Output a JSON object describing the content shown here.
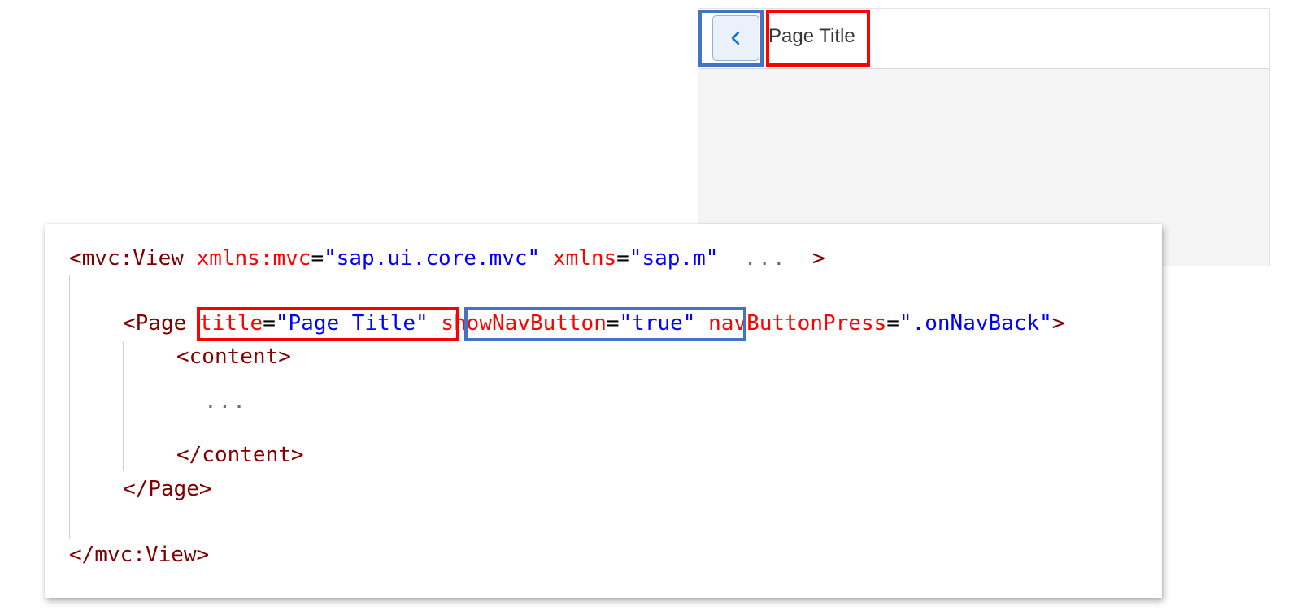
{
  "preview": {
    "page_title": "Page Title",
    "nav_button_icon": "chevron-left-icon"
  },
  "code": {
    "line1": {
      "open": "<mvc:View",
      "attr1": "xmlns:mvc",
      "eq1": "=",
      "val1": "\"sap.ui.core.mvc\"",
      "attr2": "xmlns",
      "eq2": "=",
      "val2": "\"sap.m\"",
      "ellipsis": "...",
      "close": ">"
    },
    "line2": {
      "open": "<Page",
      "attr1": "title",
      "eq1": "=",
      "val1": "\"Page Title\"",
      "attr2": "showNavButton",
      "eq2": "=",
      "val2": "\"true\"",
      "attr3": "navButtonPress",
      "eq3": "=",
      "val3": "\".onNavBack\"",
      "close": ">"
    },
    "line3": "<content>",
    "line4": "...",
    "line5": "</content>",
    "line6": "</Page>",
    "line7": "</mvc:View>"
  },
  "colors": {
    "highlight_red": "#ff0000",
    "highlight_blue": "#4472c4",
    "xml_tag": "#800000",
    "xml_attribute": "#ff0000",
    "xml_value": "#0000ff"
  }
}
